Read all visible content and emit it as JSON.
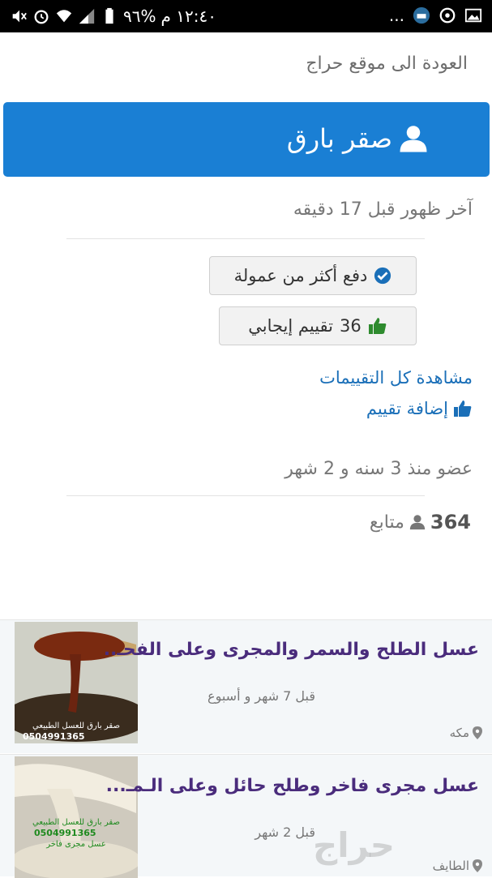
{
  "status_bar": {
    "time": "١٢:٤٠ م",
    "battery": "%٩٦",
    "more": "..."
  },
  "back_link": "العودة الى موقع حراج",
  "profile": {
    "name": "صقر بارق",
    "last_seen": "آخر ظهور قبل 17 دقيقه",
    "paid_badge": "دفع أكثر من عمولة",
    "rating_count": "36",
    "rating_label": "تقييم إيجابي",
    "view_all_ratings": "مشاهدة كل التقييمات",
    "add_rating": "إضافة تقييم",
    "member_since": "عضو منذ 3 سنه و 2 شهر",
    "followers_count": "364",
    "followers_label": "متابع"
  },
  "listings": [
    {
      "title": "عسل الطلح والسمر والمجرى وعلى الفحـ..",
      "time": "قبل 7 شهر و أسبوع",
      "city": "مكه",
      "thumb_text": "صقر بارق للعسل الطبيعي",
      "thumb_phone": "0504991365"
    },
    {
      "title": "عسل مجرى فاخر وطلح حائل وعلى الـمـ...",
      "time": "قبل 2 شهر",
      "city": "الطايف",
      "thumb_text": "صقر بارق للعسل الطبيعي",
      "thumb_phone": "0504991365",
      "thumb_caption": "عسل مجرى فاخر"
    }
  ],
  "watermark": "حراج",
  "colors": {
    "primary": "#1a7fd4",
    "link": "#1a6fb8",
    "listing_title": "#4a2c7c",
    "thumb_green": "#1f8a1f"
  }
}
